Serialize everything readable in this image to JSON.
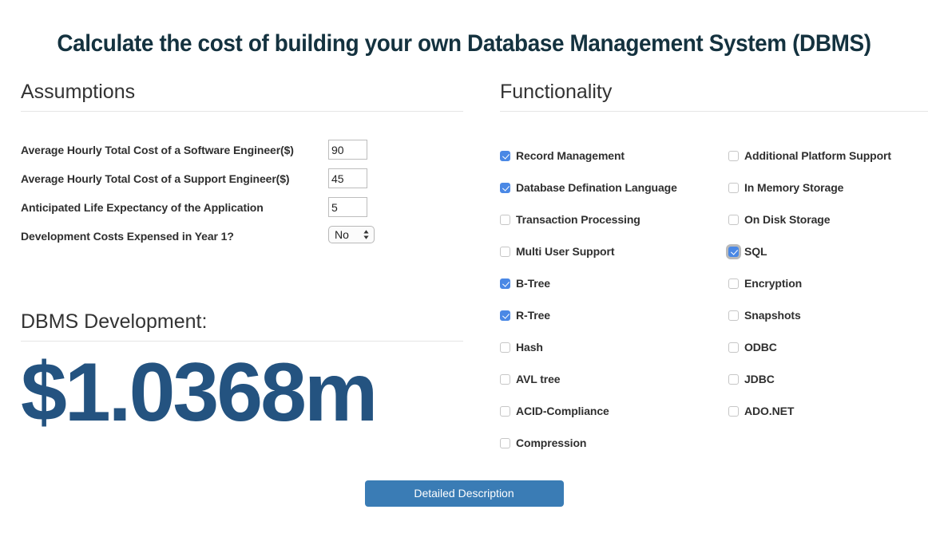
{
  "page": {
    "title": "Calculate the cost of building your own Database Management System (DBMS)",
    "title_color": "#14323f"
  },
  "assumptions": {
    "heading": "Assumptions",
    "rows": [
      {
        "label": "Average Hourly Total Cost of a Software Engineer($)",
        "type": "text",
        "value": "90",
        "placeholder": ""
      },
      {
        "label": "Average Hourly Total Cost of a Support Engineer($)",
        "type": "text",
        "value": "45",
        "placeholder": ""
      },
      {
        "label": "Anticipated Life Expectancy of the Application",
        "type": "text",
        "value": "5",
        "placeholder": ""
      },
      {
        "label": "Development Costs Expensed in Year 1?",
        "type": "select",
        "value": "No",
        "options": [
          "No",
          "Yes"
        ]
      }
    ]
  },
  "development": {
    "heading": "DBMS Development:",
    "amount": "$1.0368m",
    "amount_color": "#245380"
  },
  "functionality": {
    "heading": "Functionality",
    "accent_color": "#4a88e5",
    "left_column": [
      {
        "label": "Record Management",
        "checked": true,
        "focused": false
      },
      {
        "label": "Database Defination Language",
        "checked": true,
        "focused": false
      },
      {
        "label": "Transaction Processing",
        "checked": false,
        "focused": false
      },
      {
        "label": "Multi User Support",
        "checked": false,
        "focused": false
      },
      {
        "label": "B-Tree",
        "checked": true,
        "focused": false
      },
      {
        "label": "R-Tree",
        "checked": true,
        "focused": false
      },
      {
        "label": "Hash",
        "checked": false,
        "focused": false
      },
      {
        "label": "AVL tree",
        "checked": false,
        "focused": false
      },
      {
        "label": "ACID-Compliance",
        "checked": false,
        "focused": false
      },
      {
        "label": "Compression",
        "checked": false,
        "focused": false
      }
    ],
    "right_column": [
      {
        "label": "Additional Platform Support",
        "checked": false,
        "focused": false
      },
      {
        "label": "In Memory Storage",
        "checked": false,
        "focused": false
      },
      {
        "label": "On Disk Storage",
        "checked": false,
        "focused": false
      },
      {
        "label": "SQL",
        "checked": true,
        "focused": true
      },
      {
        "label": "Encryption",
        "checked": false,
        "focused": false
      },
      {
        "label": "Snapshots",
        "checked": false,
        "focused": false
      },
      {
        "label": "ODBC",
        "checked": false,
        "focused": false
      },
      {
        "label": "JDBC",
        "checked": false,
        "focused": false
      },
      {
        "label": "ADO.NET",
        "checked": false,
        "focused": false
      }
    ]
  },
  "footer": {
    "button_label": "Detailed Description",
    "button_color": "#3a7cb5"
  }
}
